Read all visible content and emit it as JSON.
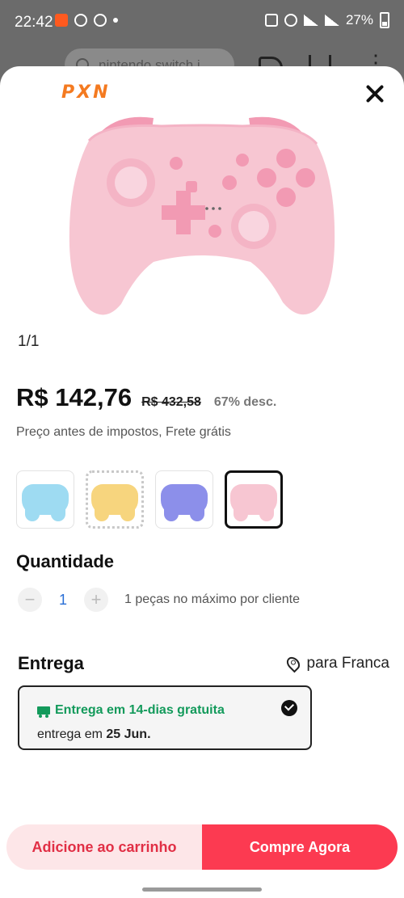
{
  "status_bar": {
    "time": "22:42",
    "battery": "27%"
  },
  "background": {
    "search_text": "nintendo switch i"
  },
  "product": {
    "brand_logo": "PXN",
    "image_counter": "1/1",
    "price": "R$ 142,76",
    "original_price": "R$ 432,58",
    "discount": "67% desc.",
    "tax_note": "Preço antes de impostos, Frete grátis",
    "variants": [
      {
        "color": "#9edbf2",
        "state": "available"
      },
      {
        "color": "#f7d57e",
        "state": "unavailable"
      },
      {
        "color": "#8c8fea",
        "state": "available"
      },
      {
        "color": "#f7c6d2",
        "state": "selected"
      }
    ]
  },
  "quantity": {
    "title": "Quantidade",
    "minus": "−",
    "value": "1",
    "plus": "+",
    "limit_text": "1 peças no máximo por cliente"
  },
  "delivery": {
    "title": "Entrega",
    "destination": "para Franca",
    "option_title": "Entrega em 14-dias gratuita",
    "date_prefix": "entrega em",
    "date": "25 Jun."
  },
  "actions": {
    "add_to_cart": "Adicione ao carrinho",
    "buy_now": "Compre Agora"
  },
  "colors": {
    "accent": "#fc3a51",
    "shipping_green": "#139a5b",
    "controller_pink": "#f7c6d2"
  }
}
